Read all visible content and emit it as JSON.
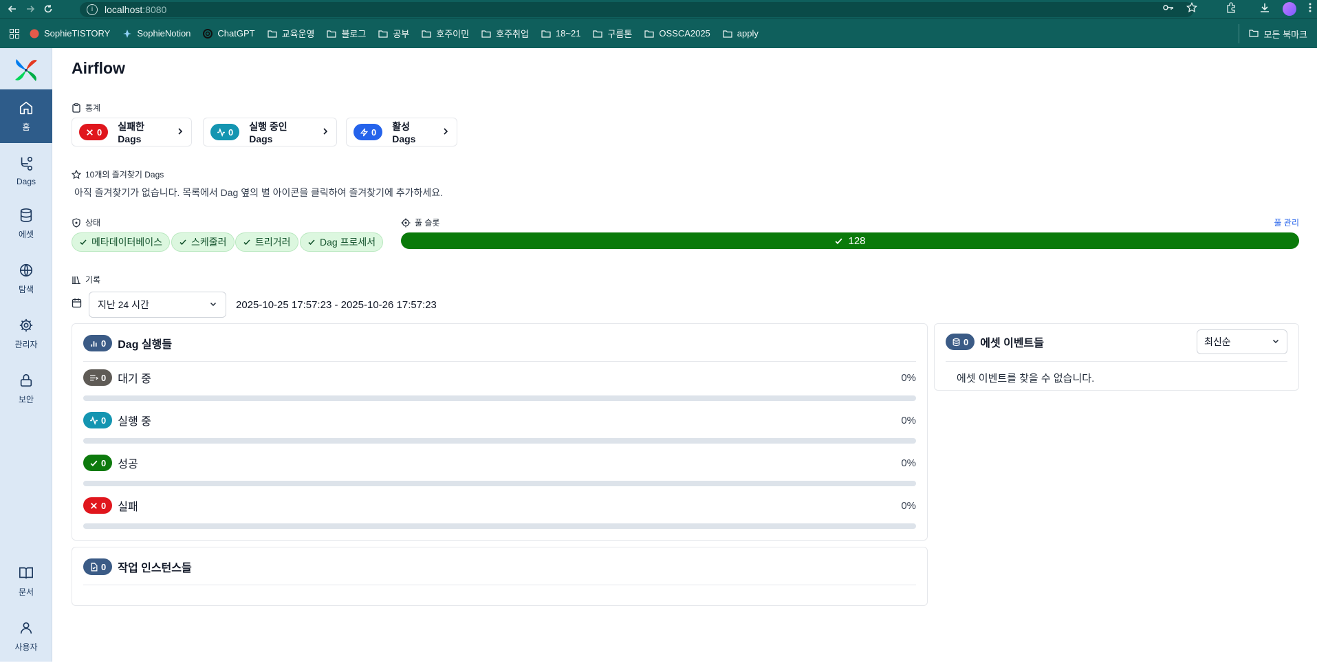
{
  "browser": {
    "url_host": "localhost",
    "url_port": ":8080",
    "bookmarks": [
      {
        "label": "SophieTISTORY",
        "icon": "tistory-icon"
      },
      {
        "label": "SophieNotion",
        "icon": "notion-icon"
      },
      {
        "label": "ChatGPT",
        "icon": "chatgpt-icon"
      },
      {
        "label": "교육운영",
        "icon": "folder-icon"
      },
      {
        "label": "블로그",
        "icon": "folder-icon"
      },
      {
        "label": "공부",
        "icon": "folder-icon"
      },
      {
        "label": "호주이민",
        "icon": "folder-icon"
      },
      {
        "label": "호주취업",
        "icon": "folder-icon"
      },
      {
        "label": "18~21",
        "icon": "folder-icon"
      },
      {
        "label": "구름톤",
        "icon": "folder-icon"
      },
      {
        "label": "OSSCA2025",
        "icon": "folder-icon"
      },
      {
        "label": "apply",
        "icon": "folder-icon"
      }
    ],
    "all_bookmarks": "모든 북마크"
  },
  "sidebar": {
    "items": [
      {
        "label": "홈",
        "icon": "home-icon",
        "active": true
      },
      {
        "label": "Dags",
        "icon": "dags-icon"
      },
      {
        "label": "에셋",
        "icon": "database-icon"
      },
      {
        "label": "탐색",
        "icon": "globe-icon"
      },
      {
        "label": "관리자",
        "icon": "gear-icon"
      },
      {
        "label": "보안",
        "icon": "lock-icon"
      }
    ],
    "bottom": [
      {
        "label": "문서",
        "icon": "book-icon"
      },
      {
        "label": "사용자",
        "icon": "user-icon"
      }
    ]
  },
  "page": {
    "title": "Airflow",
    "stats_label": "통계",
    "stats": [
      {
        "count": "0",
        "label": "실패한 Dags",
        "color": "#e0161d",
        "icon": "x-icon"
      },
      {
        "count": "0",
        "label": "실행 중인 Dags",
        "color": "#1495b1",
        "icon": "activity-icon"
      },
      {
        "count": "0",
        "label": "활성 Dags",
        "color": "#2563eb",
        "icon": "zap-icon"
      }
    ],
    "favorites_label": "10개의 즐겨찾기 Dags",
    "favorites_empty": "아직 즐겨찾기가 없습니다. 목록에서 Dag 옆의 별 아이콘을 클릭하여 즐겨찾기에 추가하세요.",
    "health_label": "상태",
    "health": [
      "메타데이터베이스",
      "스케줄러",
      "트리거러",
      "Dag 프로세서"
    ],
    "pool_label": "풀 슬롯",
    "pool_value": "128",
    "pool_manage": "풀 관리",
    "history_label": "기록",
    "date_select": "지난 24 시간",
    "date_range": "2025-10-25 17:57:23 - 2025-10-26 17:57:23"
  },
  "dag_runs": {
    "count": "0",
    "title": "Dag 실행들",
    "rows": [
      {
        "count": "0",
        "label": "대기 중",
        "pct": "0%",
        "color": "#5f5b56",
        "icon": "queue-icon"
      },
      {
        "count": "0",
        "label": "실행 중",
        "pct": "0%",
        "color": "#1495b1",
        "icon": "activity-icon"
      },
      {
        "count": "0",
        "label": "성공",
        "pct": "0%",
        "color": "#0d7a0d",
        "icon": "check-icon"
      },
      {
        "count": "0",
        "label": "실패",
        "pct": "0%",
        "color": "#e0161d",
        "icon": "x-icon"
      }
    ]
  },
  "task_instances": {
    "count": "0",
    "title": "작업 인스턴스들"
  },
  "asset_events": {
    "count": "0",
    "title": "에셋 이벤트들",
    "sort": "최신순",
    "empty": "에셋 이벤트를 찾을 수 없습니다."
  }
}
